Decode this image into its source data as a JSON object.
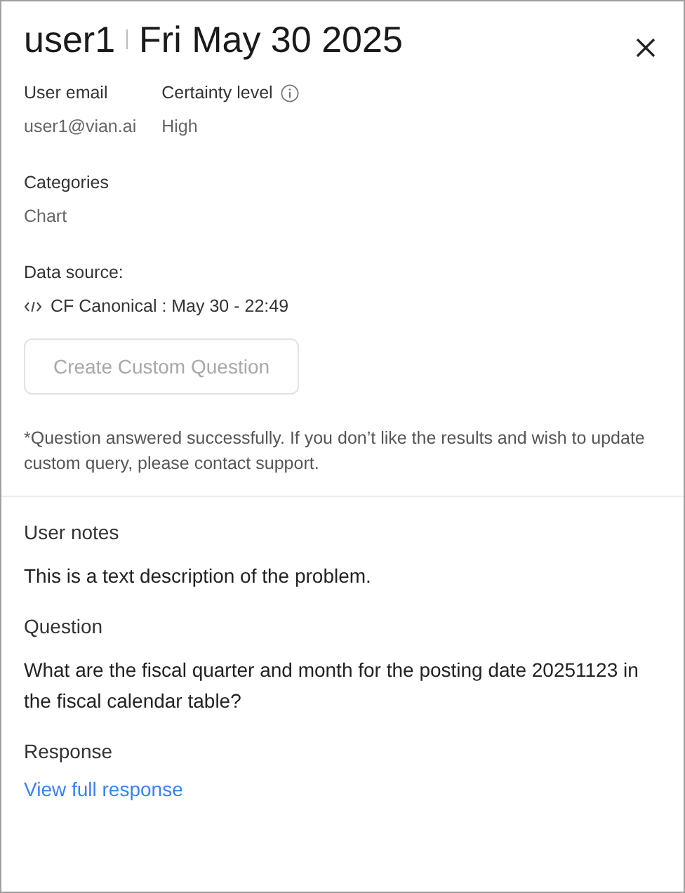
{
  "header": {
    "user": "user1",
    "date": "Fri May 30 2025"
  },
  "fields": [
    {
      "label": "User email",
      "value": "user1@vian.ai",
      "kind": "plain"
    },
    {
      "label": "Certainty level",
      "value": "High",
      "kind": "info"
    }
  ],
  "categories": {
    "label": "Categories",
    "value": "Chart"
  },
  "data_source": {
    "label": "Data source:",
    "value": "CF Canonical : May 30 - 22:49"
  },
  "action_button": {
    "label": "Create Custom Question",
    "disabled": true
  },
  "note": "*Question answered successfully. If you don’t like the results and wish to update custom query, please contact support.",
  "sections": [
    {
      "title": "User notes",
      "text": "This is a text description of the problem.",
      "kind": "text"
    },
    {
      "title": "Question",
      "text": "What are the fiscal quarter and month for the posting date 20251123 in the fiscal calendar table?",
      "kind": "text"
    },
    {
      "title": "Response",
      "text": "View full response",
      "kind": "link"
    }
  ]
}
